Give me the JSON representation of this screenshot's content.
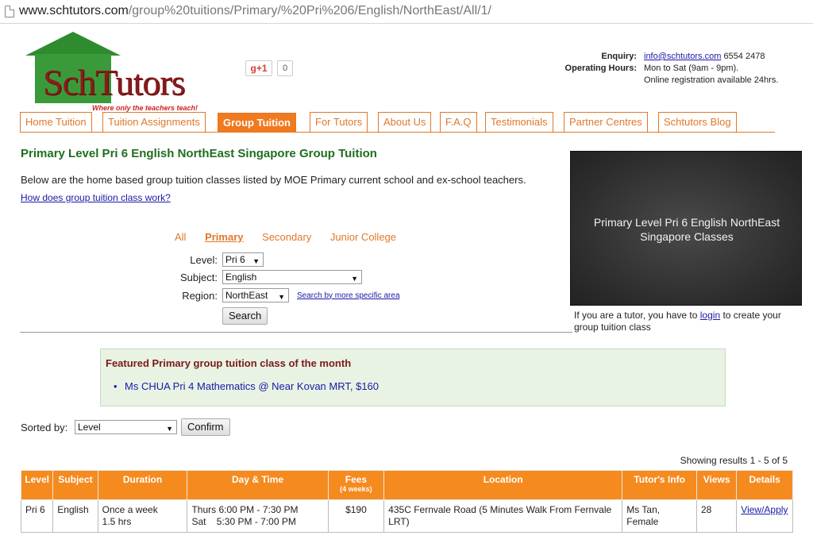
{
  "browser": {
    "url_host": "www.schtutors.com",
    "url_path": "/group%20tuitions/Primary/%20Pri%206/English/NorthEast/All/1/"
  },
  "logo": {
    "brand": "SchTutors",
    "tagline": "Where only the teachers teach!"
  },
  "social": {
    "gplus_label": "g+1",
    "gplus_count": "0"
  },
  "contact": {
    "enquiry_label": "Enquiry:",
    "email": "info@schtutors.com",
    "phone": "6554 2478",
    "hours_label": "Operating Hours:",
    "hours": "Mon to Sat (9am - 9pm).",
    "online_note": "Online registration available 24hrs."
  },
  "nav": {
    "tabs": [
      "Home Tuition",
      "Tuition Assignments",
      "Group Tuition",
      "For Tutors",
      "About Us",
      "F.A.Q",
      "Testimonials",
      "Partner Centres",
      "Schtutors Blog"
    ],
    "active_index": 2
  },
  "main": {
    "heading": "Primary Level Pri 6 English NorthEast Singapore Group Tuition",
    "intro": "Below are the home based group tuition classes listed by MOE Primary current school and ex-school teachers.",
    "how_link": "How does group tuition class work?"
  },
  "levels": {
    "items": [
      "All",
      "Primary",
      "Secondary",
      "Junior College"
    ],
    "active": "Primary"
  },
  "filters": {
    "level_label": "Level:",
    "level_value": "Pri 6",
    "subject_label": "Subject:",
    "subject_value": "English",
    "region_label": "Region:",
    "region_value": "NorthEast",
    "specific_area_link": "Search by more specific area",
    "search_button": "Search"
  },
  "board": {
    "text": "Primary Level Pri 6 English NorthEast Singapore Classes"
  },
  "tutor_note": {
    "before": "If you are a tutor, you have to ",
    "link": "login",
    "after": " to create your group tuition class"
  },
  "featured": {
    "title": "Featured Primary group tuition class of the month",
    "item": "Ms CHUA Pri 4 Mathematics @ Near Kovan MRT, $160"
  },
  "sort": {
    "label": "Sorted by:",
    "value": "Level",
    "confirm_button": "Confirm"
  },
  "results": {
    "showing": "Showing results 1 - 5 of 5",
    "headers": {
      "level": "Level",
      "subject": "Subject",
      "duration": "Duration",
      "daytime": "Day & Time",
      "fees": "Fees",
      "fees_sub": "(4 weeks)",
      "location": "Location",
      "tutor": "Tutor's Info",
      "views": "Views",
      "details": "Details"
    },
    "rows": [
      {
        "level": "Pri 6",
        "subject": "English",
        "duration_1": "Once a week",
        "duration_2": "1.5 hrs",
        "day_1": "Thurs 6:00 PM - 7:30 PM",
        "day_2": "Sat    5:30 PM - 7:00 PM",
        "fees": "$190",
        "location": "435C Fernvale Road (5 Minutes Walk From Fernvale LRT)",
        "tutor_1": "Ms Tan,",
        "tutor_2": "Female",
        "views": "28",
        "details": "View/Apply"
      }
    ]
  },
  "colors": {
    "accent_orange": "#f07a1e",
    "heading_green": "#1f6e1f",
    "featured_bg": "#e8f3e4",
    "link_blue": "#1a1aa6"
  }
}
